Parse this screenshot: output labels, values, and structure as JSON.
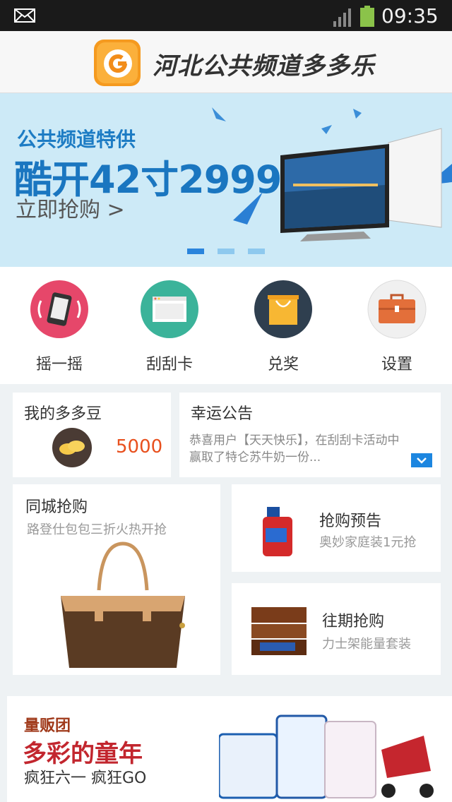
{
  "status_bar": {
    "time": "09:35"
  },
  "header": {
    "title": "河北公共频道多多乐"
  },
  "banner": {
    "line1": "公共频道特供",
    "line2": "酷开42寸2999",
    "line3": "立即抢购 >",
    "active_dot": 0
  },
  "quick_actions": [
    {
      "label": "摇一摇"
    },
    {
      "label": "刮刮卡"
    },
    {
      "label": "兑奖"
    },
    {
      "label": "设置"
    }
  ],
  "beans_card": {
    "title": "我的多多豆",
    "count": "5000"
  },
  "notice_card": {
    "title": "幸运公告",
    "text": "恭喜用户【天天快乐】，在刮刮卡活动中赢取了特仑苏牛奶一份..."
  },
  "city_card": {
    "title": "同城抢购",
    "subtitle": "路登仕包包三折火热开抢"
  },
  "preview_card": {
    "title": "抢购预告",
    "subtitle": "奥妙家庭装1元抢"
  },
  "past_card": {
    "title": "往期抢购",
    "subtitle": "力士架能量套装"
  },
  "bottom_banner": {
    "line1": "量贩团",
    "line2": "多彩的童年",
    "line3": "疯狂六一 疯狂GO"
  },
  "colors": {
    "accent": "#1c86e0",
    "banner_bg": "#cdeaf7",
    "bean_count": "#e8501e"
  }
}
